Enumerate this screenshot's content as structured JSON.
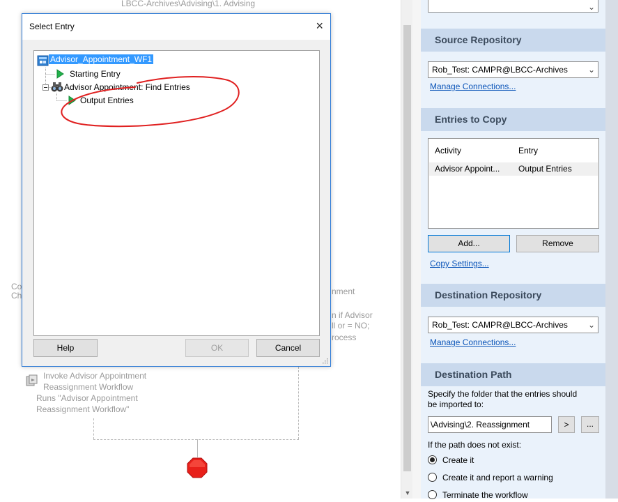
{
  "canvas": {
    "top_path": "LBCC-Archives\\Advising\\1. Advising",
    "left_frag_1": "Co",
    "left_frag_2": "Ch",
    "right_frag_1": "nment",
    "right_frag_2": "n if Advisor",
    "right_frag_3": "ll or = NO;",
    "right_frag_4": "rocess",
    "invoke_title_1": "Invoke Advisor Appointment",
    "invoke_title_2": "Reassignment Workflow",
    "invoke_desc_1": "Runs \"Advisor Appointment",
    "invoke_desc_2": "Reassignment Workflow\""
  },
  "dialog": {
    "title": "Select Entry",
    "close": "×",
    "tree": {
      "root": "Advisor_Appointment_WF1",
      "starting_entry": "Starting Entry",
      "find_entries": "Advisor Appointment: Find Entries",
      "output_entries": "Output Entries"
    },
    "help_label": "Help",
    "ok_label": "OK",
    "cancel_label": "Cancel",
    "annotation_color": "#e02020"
  },
  "panel": {
    "source_repository": {
      "heading": "Source Repository",
      "value": "Rob_Test: CAMPR@LBCC-Archives",
      "manage_link": "Manage Connections..."
    },
    "entries_to_copy": {
      "heading": "Entries to Copy",
      "columns": [
        "Activity",
        "Entry"
      ],
      "rows": [
        [
          "Advisor Appoint...",
          "Output Entries"
        ]
      ],
      "add_label": "Add...",
      "remove_label": "Remove",
      "copy_settings_link": "Copy Settings..."
    },
    "destination_repository": {
      "heading": "Destination Repository",
      "value": "Rob_Test: CAMPR@LBCC-Archives",
      "manage_link": "Manage Connections..."
    },
    "destination_path": {
      "heading": "Destination Path",
      "description_1": "Specify the folder that the entries should",
      "description_2": "be imported to:",
      "path_value": "\\Advising\\2. Reassignment",
      "browse_arrow": ">",
      "browse_dots": "...",
      "not_exist_label": "If the path does not exist:",
      "options": [
        "Create it",
        "Create it and report a warning",
        "Terminate the workflow"
      ],
      "selected_option": "Create it"
    }
  },
  "colors": {
    "accent": "#2b79d6",
    "selection": "#3399ff",
    "panel_bg": "#eaf2fb",
    "section_header_bg": "#c9d9ed",
    "link": "#0a54b8",
    "stop_icon": "#e8201a"
  }
}
